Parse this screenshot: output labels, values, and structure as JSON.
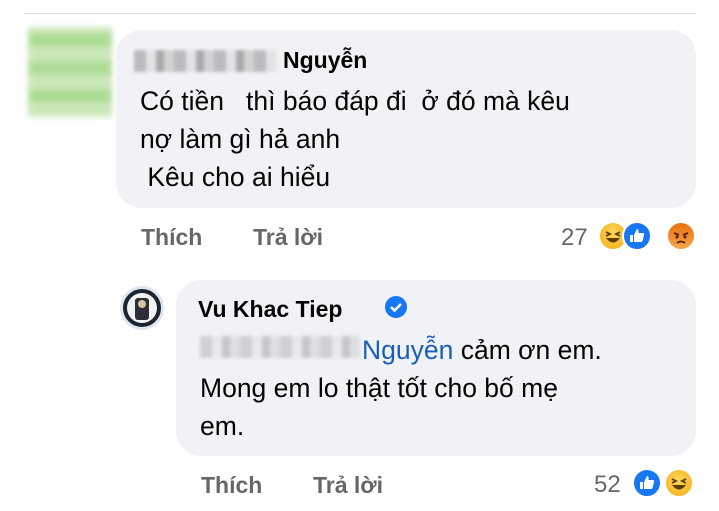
{
  "comment1": {
    "author": "Nguyễn",
    "lines": [
      "Có tiền   thì báo đáp đi  ở đó mà kêu",
      "nợ làm gì hả anh",
      " Kêu cho ai hiểu"
    ],
    "like_label": "Thích",
    "reply_label": "Trả lời",
    "reaction_count": "27",
    "reactions": [
      "haha-icon",
      "like-icon",
      "angry-icon"
    ]
  },
  "comment2": {
    "author": "Vu Khac Tiep",
    "mention": "Nguyễn",
    "line1_rest": " cảm ơn em.",
    "line2": "Mong em lo thật tốt cho bố mẹ",
    "line3": "em.",
    "like_label": "Thích",
    "reply_label": "Trả lời",
    "reaction_count": "52",
    "reactions": [
      "like-icon",
      "haha-icon"
    ]
  },
  "colors": {
    "bubble": "#f0f2f5",
    "text": "#050505",
    "secondary": "#65676b",
    "mention": "#1a5eb7",
    "like_blue": "#1877f2"
  }
}
